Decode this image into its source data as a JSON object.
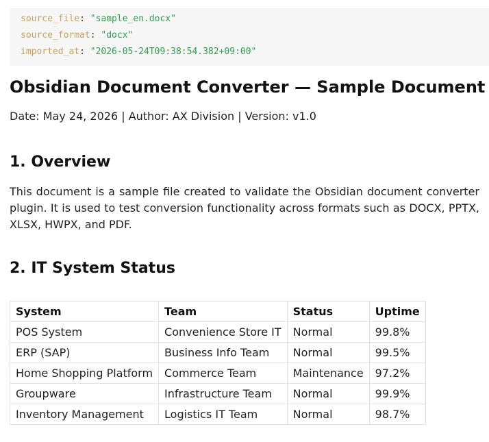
{
  "frontmatter": [
    {
      "key": "source_file",
      "sep": ": ",
      "value": "\"sample_en.docx\""
    },
    {
      "key": "source_format",
      "sep": ": ",
      "value": "\"docx\""
    },
    {
      "key": "imported_at",
      "sep": ": ",
      "value": "\"2026-05-24T09:38:54.382+09:00\""
    }
  ],
  "document": {
    "title": "Obsidian Document Converter — Sample Document",
    "meta": "Date: May 24, 2026 | Author: AX Division | Version: v1.0"
  },
  "sections": [
    {
      "heading": "1. Overview",
      "body": "This document is a sample file created to validate the Obsidian document converter plugin. It is used to test conversion functionality across formats such as DOCX, PPTX, XLSX, HWPX, and PDF."
    },
    {
      "heading": "2. IT System Status"
    }
  ],
  "table": {
    "headers": [
      "System",
      "Team",
      "Status",
      "Uptime"
    ],
    "rows": [
      [
        "POS System",
        "Convenience Store IT",
        "Normal",
        "99.8%"
      ],
      [
        "ERP (SAP)",
        "Business Info Team",
        "Normal",
        "99.5%"
      ],
      [
        "Home Shopping Platform",
        "Commerce Team",
        "Maintenance",
        "97.2%"
      ],
      [
        "Groupware",
        "Infrastructure Team",
        "Normal",
        "99.9%"
      ],
      [
        "Inventory Management",
        "Logistics IT Team",
        "Normal",
        "98.7%"
      ]
    ]
  },
  "colors": {
    "frontmatter_key": "#c7a25a",
    "frontmatter_value": "#2e9e4f",
    "frontmatter_bg": "#f6f6f6"
  }
}
